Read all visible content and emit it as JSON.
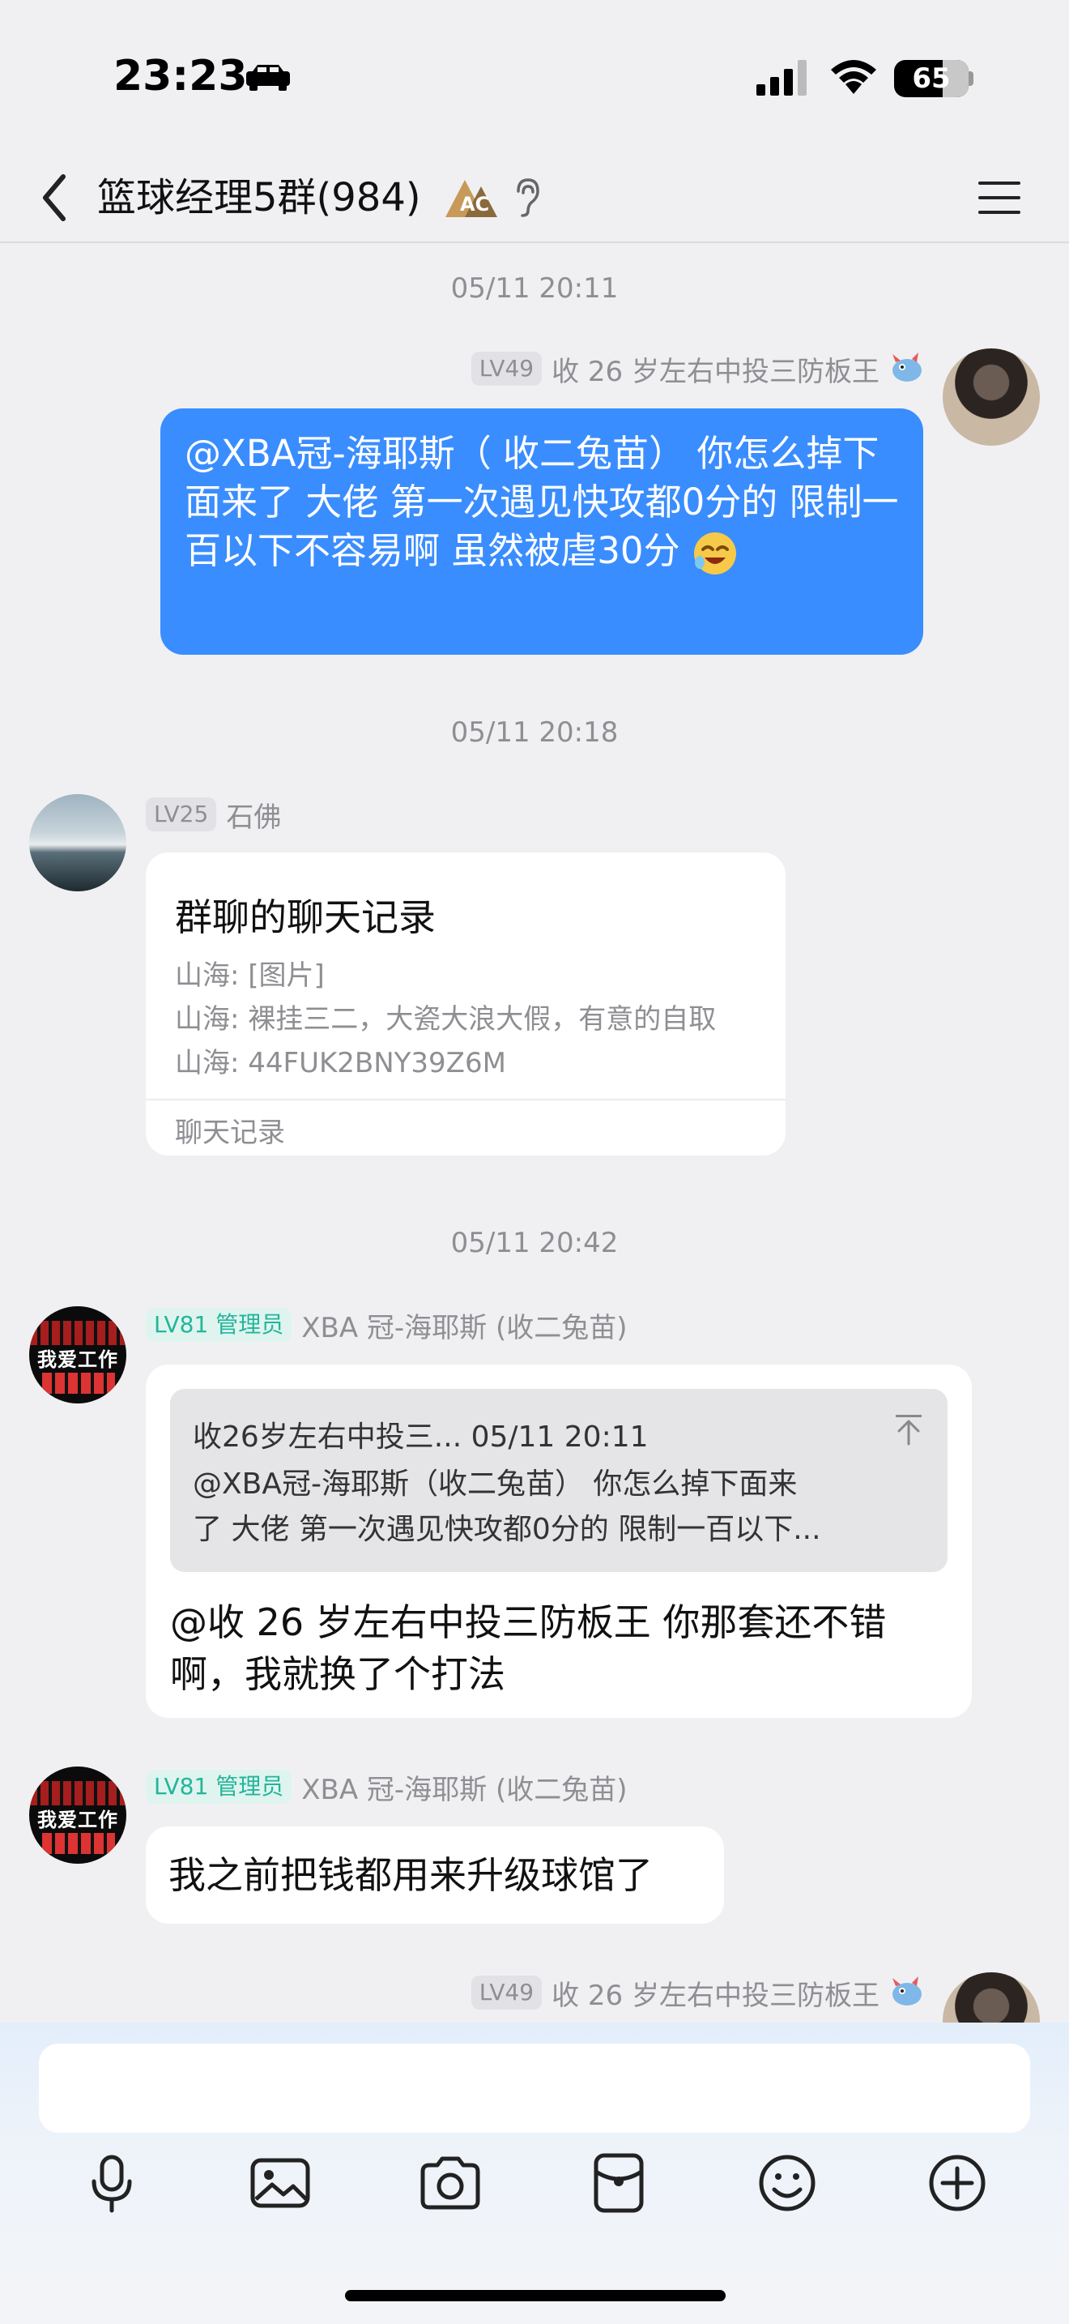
{
  "status_bar": {
    "time": "23:23",
    "battery": "65"
  },
  "nav": {
    "title": "篮球经理5群(984)",
    "badge_text": "AC"
  },
  "messages": [
    {
      "timestamp": "05/11 20:11",
      "level": "LV49",
      "sender": "收 26 岁左右中投三防板王",
      "text": "@XBA冠-海耶斯（ 收二兔苗） 你怎么掉下面来了 大佬 第一次遇见快攻都0分的 限制一百以下不容易啊 虽然被虐30分"
    },
    {
      "timestamp": "05/11 20:18",
      "level": "LV25",
      "sender": "石佛",
      "record": {
        "title": "群聊的聊天记录",
        "lines": [
          "山海: [图片]",
          "山海: 裸挂三二，大瓷大浪大假，有意的自取",
          "山海: 44FUK2BNY39Z6M"
        ],
        "footer": "聊天记录"
      }
    },
    {
      "timestamp": "05/11 20:42",
      "level": "LV81 管理员",
      "sender": "XBA 冠-海耶斯 (收二兔苗)",
      "quote": {
        "header": "收26岁左右中投三... 05/11 20:11",
        "line1": "@XBA冠-海耶斯（收二兔苗） 你怎么掉下面来",
        "line2": "了 大佬 第一次遇见快攻都0分的 限制一百以下..."
      },
      "text": "@收 26 岁左右中投三防板王 你那套还不错啊，我就换了个打法"
    },
    {
      "level": "LV81 管理员",
      "sender": "XBA 冠-海耶斯 (收二兔苗)",
      "text": "我之前把钱都用来升级球馆了"
    },
    {
      "level": "LV49",
      "sender": "收 26 岁左右中投三防板王"
    }
  ],
  "avatars": {
    "xba_text": "我爱工作"
  },
  "colors": {
    "self_bubble": "#3a8dff",
    "admin_badge": "#23b59a",
    "background": "#f0f0f2"
  },
  "toolbar": {
    "icons": [
      "microphone-icon",
      "image-icon",
      "camera-icon",
      "red-packet-icon",
      "emoji-icon",
      "plus-icon"
    ]
  }
}
